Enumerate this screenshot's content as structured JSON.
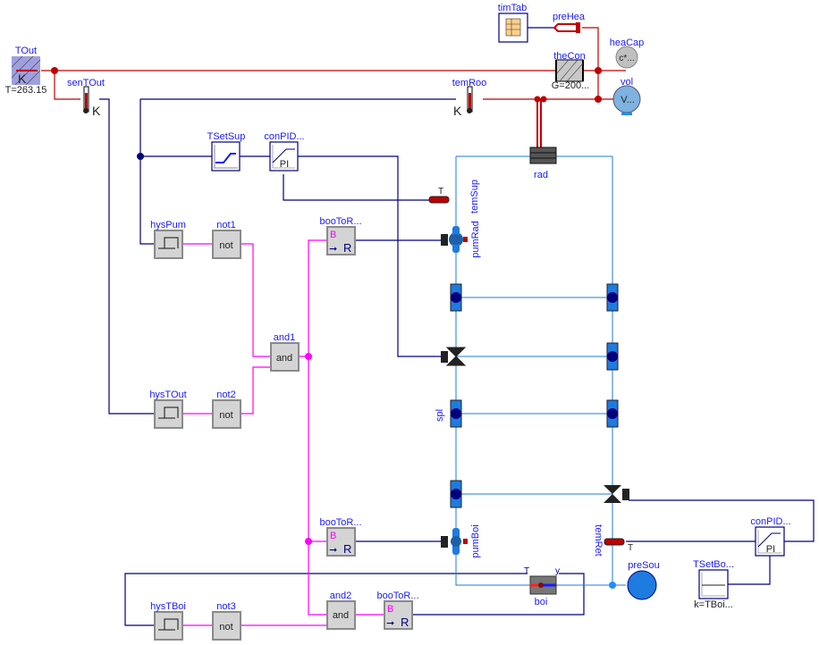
{
  "components": {
    "TOut": {
      "name": "TOut",
      "param": "T=263.15",
      "unit": "K"
    },
    "senTOut": {
      "name": "senTOut",
      "unit": "K"
    },
    "temRoo": {
      "name": "temRoo",
      "unit": "K"
    },
    "timTab": {
      "name": "timTab"
    },
    "preHea": {
      "name": "preHea"
    },
    "theCon": {
      "name": "theCon",
      "param": "G=200..."
    },
    "heaCap": {
      "name": "heaCap",
      "inner": "c*..."
    },
    "vol": {
      "name": "vol",
      "inner": "V..."
    },
    "TSetSup": {
      "name": "TSetSup"
    },
    "conPIDRad": {
      "name": "conPID...",
      "inner": "PI"
    },
    "rad": {
      "name": "rad"
    },
    "temSup": {
      "name": "temSup",
      "port": "T"
    },
    "pumRad": {
      "name": "pumRad"
    },
    "spl": {
      "name": "spl"
    },
    "hysPum": {
      "name": "hysPum"
    },
    "not1": {
      "name": "not1",
      "inner": "not"
    },
    "hysTOut": {
      "name": "hysTOut"
    },
    "not2": {
      "name": "not2",
      "inner": "not"
    },
    "and1": {
      "name": "and1",
      "inner": "and"
    },
    "booToRRad": {
      "name": "booToR...",
      "in": "B",
      "out": "R"
    },
    "booToRBoi": {
      "name": "booToR...",
      "in": "B",
      "out": "R"
    },
    "booToRBoi2": {
      "name": "booToR...",
      "in": "B",
      "out": "R"
    },
    "hysTBoi": {
      "name": "hysTBoi"
    },
    "not3": {
      "name": "not3",
      "inner": "not"
    },
    "and2": {
      "name": "and2",
      "inner": "and"
    },
    "pumBoi": {
      "name": "pumBoi"
    },
    "temRet": {
      "name": "temRet",
      "port": "T"
    },
    "boi": {
      "name": "boi",
      "portT": "T",
      "portY": "y"
    },
    "preSou": {
      "name": "preSou"
    },
    "TSetBoi": {
      "name": "TSetBo...",
      "param": "k=TBoi..."
    },
    "conPIDBoi": {
      "name": "conPID...",
      "inner": "PI"
    }
  },
  "colors": {
    "signal": "#00007f",
    "boolean": "#ff00ff",
    "heat": "#bf0000",
    "fluid": "#1e7be0",
    "label": "#1a1aff"
  }
}
